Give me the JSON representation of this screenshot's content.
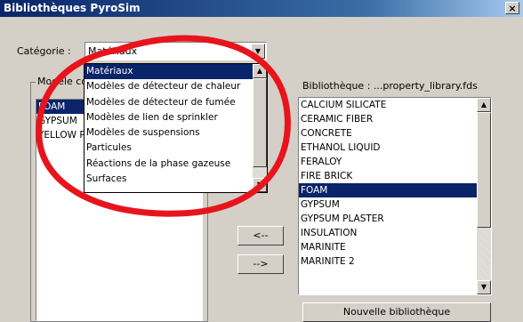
{
  "window": {
    "title": "Bibliothèques PyroSim",
    "close_glyph": "×"
  },
  "category": {
    "label": "Catégorie :",
    "value": "Matériaux",
    "options": [
      "Matériaux",
      "Modèles de détecteur de chaleur",
      "Modèles de détecteur de fumée",
      "Modèles de lien de sprinkler",
      "Modèles de suspensions",
      "Particules",
      "Réactions de la phase gazeuse",
      "Surfaces"
    ],
    "selected_index": 0
  },
  "model": {
    "label": "Modèle courant",
    "items": [
      "FOAM",
      "GYPSUM",
      "YELLOW PINE"
    ],
    "selected_index": 0
  },
  "library": {
    "label": "Bibliothèque : ...property_library.fds",
    "items": [
      "CALCIUM SILICATE",
      "CERAMIC FIBER",
      "CONCRETE",
      "ETHANOL LIQUID",
      "FERALOY",
      "FIRE BRICK",
      "FOAM",
      "GYPSUM",
      "GYPSUM PLASTER",
      "INSULATION",
      "MARINITE",
      "MARINITE 2"
    ],
    "selected_index": 6,
    "new_library_button": "Nouvelle bibliothèque"
  },
  "transfer": {
    "left_button": "<--",
    "right_button": "-->"
  },
  "annotation": {
    "color": "#e8141c"
  },
  "icons": {
    "scroll_up": "▲",
    "scroll_down": "▼",
    "combo_arrow": "▼"
  }
}
